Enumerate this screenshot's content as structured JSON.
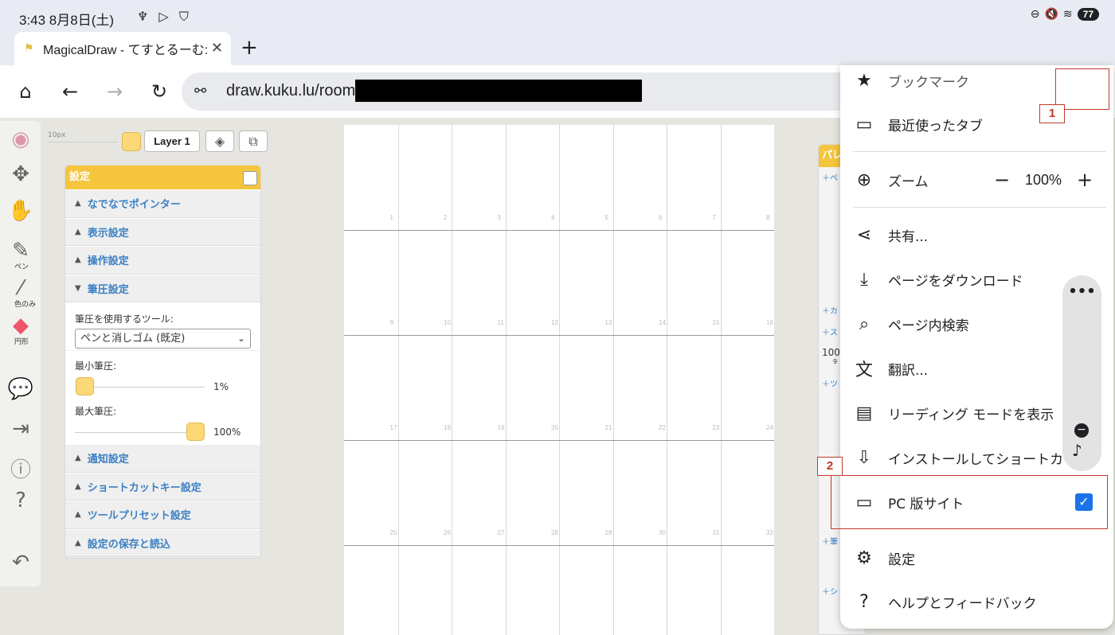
{
  "status": {
    "time": "3:43  8月8日(土)",
    "left_icons": "♆ ▷ ⛉",
    "battery": "77"
  },
  "tab": {
    "title": "MagicalDraw - てすとるーむ:",
    "close": "✕",
    "new": "+"
  },
  "toolbar": {
    "home_icon": "⌂",
    "back_icon": "←",
    "forward_icon": "→",
    "reload_icon": "↻",
    "url": "draw.kuku.lu/room/"
  },
  "tools": [
    {
      "name": "color-wheel-icon",
      "glyph": "◉",
      "label": ""
    },
    {
      "name": "move-icon",
      "glyph": "✥",
      "label": ""
    },
    {
      "name": "hand-icon",
      "glyph": "✋",
      "label": ""
    },
    {
      "name": "pen-icon",
      "glyph": "✎",
      "label": "ペン"
    },
    {
      "name": "eyedropper-icon",
      "glyph": "⁄",
      "label": "色のみ"
    },
    {
      "name": "eraser-icon",
      "glyph": "◆",
      "label": "円形"
    },
    {
      "name": "chat-icon",
      "glyph": "💬",
      "label": ""
    },
    {
      "name": "exit-icon",
      "glyph": "⇥",
      "label": ""
    },
    {
      "name": "info-icon",
      "glyph": "ⓘ",
      "label": ""
    },
    {
      "name": "help-icon",
      "glyph": "?",
      "label": ""
    },
    {
      "name": "undo-icon",
      "glyph": "↶",
      "label": ""
    }
  ],
  "canvas_toolbar": {
    "size_label": "10px",
    "layer": "Layer 1"
  },
  "panel": {
    "title": "設定",
    "sections_top": [
      "なでなでポインター",
      "表示設定",
      "操作設定"
    ],
    "open_section": "筆圧設定",
    "tool_label": "筆圧を使用するツール:",
    "tool_value": "ペンと消しゴム (既定)",
    "min_label": "最小筆圧:",
    "min_value": "1%",
    "min_level": 0.01,
    "max_label": "最大筆圧:",
    "max_value": "100%",
    "max_level": 1.0,
    "sections_bottom": [
      "通知設定",
      "ショートカットキー設定",
      "ツールプリセット設定",
      "設定の保存と読込"
    ]
  },
  "canvas_numbers": [
    "1",
    "2",
    "3",
    "4",
    "5",
    "6",
    "7",
    "8",
    "9",
    "10",
    "11",
    "12",
    "13",
    "14",
    "15",
    "16",
    "17",
    "18",
    "19",
    "20",
    "21",
    "22",
    "23",
    "24",
    "25",
    "26",
    "27",
    "28",
    "29",
    "30",
    "31",
    "32"
  ],
  "rpanel": {
    "title": "パレ",
    "rows": [
      "＋ペ",
      "＋カ",
      "＋ス",
      "100",
      "9",
      "＋ツ",
      "＋筆",
      "＋シ"
    ]
  },
  "menu": {
    "bookmark": {
      "icon": "★",
      "label": "ブックマーク"
    },
    "recent_tabs": {
      "icon": "▭",
      "label": "最近使ったタブ"
    },
    "zoom": {
      "icon": "⊕",
      "label": "ズーム",
      "minus": "−",
      "value": "100%",
      "plus": "+"
    },
    "share": {
      "icon": "⋖",
      "label": "共有..."
    },
    "download": {
      "icon": "⤓",
      "label": "ページをダウンロード"
    },
    "find": {
      "icon": "⌕",
      "label": "ページ内検索"
    },
    "translate": {
      "icon": "文",
      "label": "翻訳..."
    },
    "reading": {
      "icon": "▤",
      "label": "リーディング モードを表示"
    },
    "install": {
      "icon": "⇩",
      "label": "インストールしてショートカ"
    },
    "desktop": {
      "icon": "▭",
      "label": "PC 版サイト",
      "checked": "✓"
    },
    "settings": {
      "icon": "⚙",
      "label": "設定"
    },
    "help": {
      "icon": "?",
      "label": "ヘルプとフィードバック"
    }
  },
  "bubble": {
    "dots": "•••",
    "b1": "−",
    "b2": "♪"
  },
  "annotations": {
    "label1": "1",
    "label2": "2"
  }
}
